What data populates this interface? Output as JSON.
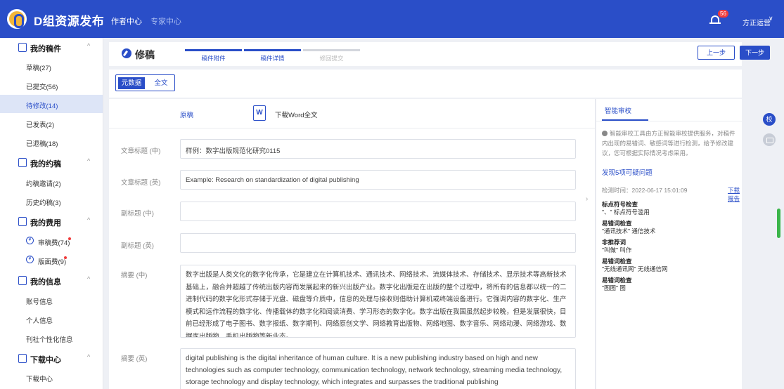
{
  "header": {
    "brand": "D组资源发布",
    "nav_primary": "作者中心",
    "nav_secondary": "专家中心",
    "notification_count": "56",
    "user_name": "方正运营",
    "chevron": "∨"
  },
  "sidebar": {
    "groups": [
      {
        "label": "我的稿件",
        "icon": "document-icon",
        "items": [
          "草稿(27)",
          "已提交(56)",
          "待修改(14)",
          "已发表(2)",
          "已退稿(18)"
        ]
      },
      {
        "label": "我的约稿",
        "icon": "invite-icon",
        "items": [
          "约稿邀请(2)",
          "历史约稿(3)"
        ]
      },
      {
        "label": "我的费用",
        "icon": "fee-icon",
        "items": [
          "审稿费(74)",
          "版面费(9)"
        ]
      },
      {
        "label": "我的信息",
        "icon": "profile-icon",
        "items": [
          "账号信息",
          "个人信息",
          "刊社个性化信息"
        ]
      },
      {
        "label": "下载中心",
        "icon": "download-icon",
        "items": [
          "下载中心"
        ]
      }
    ],
    "chevron": "^",
    "fee_icon_glyph": "¥",
    "active_item": "待修改(14)"
  },
  "steps": {
    "title": "修稿",
    "labels": [
      "稿件附件",
      "稿件详情",
      "修回提交"
    ],
    "prev": "上一步",
    "next": "下一步"
  },
  "tabs": {
    "metadata": "元数据",
    "fulltext": "全文"
  },
  "form": {
    "original_label": "原稿",
    "word_icon_glyph": "W",
    "download_word": "下载Word全文",
    "fields": [
      {
        "label": "文章标题 (中)",
        "value": "样例：数字出版规范化研究0115"
      },
      {
        "label": "文章标题 (英)",
        "value": "Example: Research on standardization of digital publishing"
      },
      {
        "label": "副标题 (中)",
        "value": ""
      },
      {
        "label": "副标题 (英)",
        "value": ""
      }
    ],
    "abstract_cn_label": "摘要 (中)",
    "abstract_cn": "数字出版是人类文化的数字化传承，它是建立在计算机技术、通讯技术、网络技术、流媒体技术、存储技术、显示技术等高新技术基础上，融合并超越了传统出版内容而发展起来的新兴出版产业。数字化出版是在出版的整个过程中，将所有的信息都以统一的二进制代码的数字化形式存储于光盘、磁盘等介质中，信息的处理与接收则借助计算机或终端设备进行。它强调内容的数字化、生产模式和运作流程的数字化、传播载体的数字化和阅读消费、学习形态的数字化。数字出版在我国虽然起步较晚，但是发展很快，目前已经形成了电子图书、数字报纸、数字期刊、网络原创文学、网络教育出版物、网络地图、数字音乐、网络动漫、网络游戏、数据库出版物、手机出版物等新业态。",
    "abstract_en_label": "摘要 (英)",
    "abstract_en": "digital publishing is the digital inheritance of human culture. It is a new publishing industry based on high and new technologies such as computer technology, communication technology, network technology, streaming media technology, storage technology and display technology, which integrates and surpasses the traditional publishing"
  },
  "review": {
    "tab": "智能审校",
    "note": "智能审校工具由方正智能审校提供服务，对稿件内出现的易错词、敏感词等进行检测，给予修改建议，您可根据实际情况考虑采用。",
    "found": "发现5项可疑问题",
    "time": "检测时间：2022-06-17 15:01:09",
    "report": "下载报告",
    "issues": [
      {
        "type": "标点符号检查",
        "text": "\"、\" 标点符号滥用"
      },
      {
        "type": "易错词检查",
        "text": "\"通讯技术\" 通信技术"
      },
      {
        "type": "非推荐词",
        "text": "\"叫做\" 叫作"
      },
      {
        "type": "易错词检查",
        "text": "\"无线通讯网\" 无线通信网"
      },
      {
        "type": "易错词检查",
        "text": "\"图图\" 图"
      }
    ],
    "collapse_glyph": "›"
  },
  "rail": {
    "check_glyph": "校"
  },
  "colors": {
    "primary": "#2a4ec8",
    "danger": "#f03a3a",
    "scroll": "#3bb54a"
  }
}
